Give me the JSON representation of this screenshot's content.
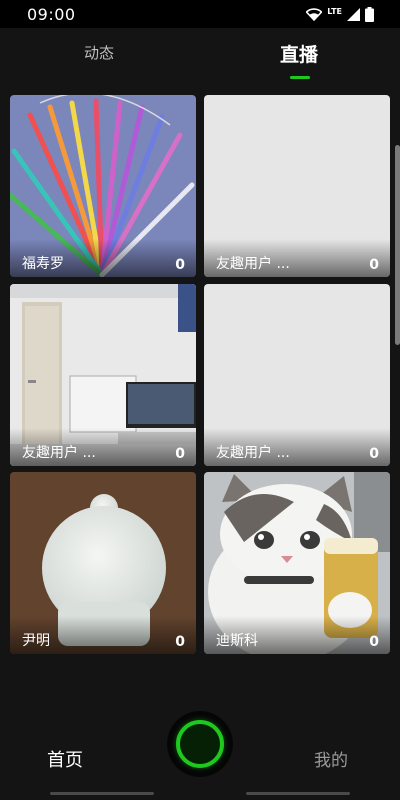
{
  "status_bar": {
    "time": "09:00",
    "network": "LTE"
  },
  "tabs": [
    {
      "label": "动态",
      "active": false
    },
    {
      "label": "直播",
      "active": true
    }
  ],
  "accent_color": "#1ec81e",
  "cards": [
    {
      "name": "福寿罗",
      "count": "0",
      "thumbnail": "pinwheels-photo"
    },
    {
      "name": "友趣用户 ...",
      "count": "0",
      "thumbnail": "blank"
    },
    {
      "name": "友趣用户 ...",
      "count": "0",
      "thumbnail": "office-desk-photo"
    },
    {
      "name": "友趣用户 ...",
      "count": "0",
      "thumbnail": "blank"
    },
    {
      "name": "尹明",
      "count": "0",
      "thumbnail": "lamp-photo"
    },
    {
      "name": "迪斯科",
      "count": "0",
      "thumbnail": "crying-cat-photo"
    }
  ],
  "bottom_nav": {
    "home_label": "首页",
    "mine_label": "我的",
    "center_icon": "live-ring-icon"
  }
}
